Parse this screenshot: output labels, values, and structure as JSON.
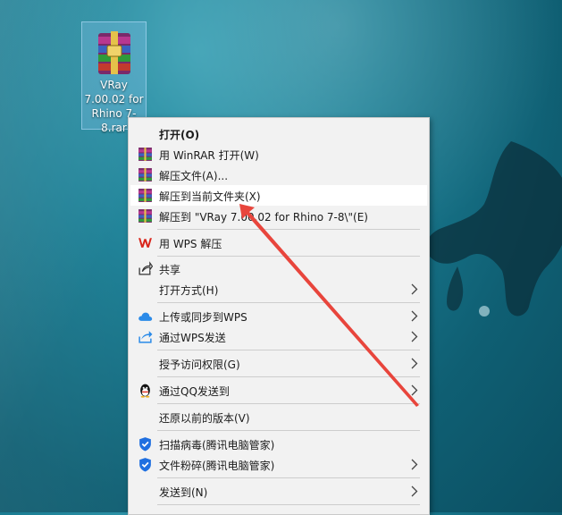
{
  "desktop": {
    "file_label": "VRay 7.00.02 for Rhino 7-8.rar"
  },
  "context_menu": {
    "items": [
      {
        "label": "打开(O)"
      },
      {
        "label": "用 WinRAR 打开(W)"
      },
      {
        "label": "解压文件(A)..."
      },
      {
        "label": "解压到当前文件夹(X)"
      },
      {
        "label": "解压到 \"VRay 7.00.02 for Rhino 7-8\\\"(E)"
      },
      {
        "label": "用 WPS 解压"
      },
      {
        "label": "共享"
      },
      {
        "label": "打开方式(H)"
      },
      {
        "label": "上传或同步到WPS"
      },
      {
        "label": "通过WPS发送"
      },
      {
        "label": "授予访问权限(G)"
      },
      {
        "label": "通过QQ发送到"
      },
      {
        "label": "还原以前的版本(V)"
      },
      {
        "label": "扫描病毒(腾讯电脑管家)"
      },
      {
        "label": "文件粉碎(腾讯电脑管家)"
      },
      {
        "label": "发送到(N)"
      }
    ],
    "highlighted_item": "解压到当前文件夹(X)"
  },
  "colors": {
    "annotation_arrow": "#e8453c",
    "wps_red": "#d9261c",
    "qqguard_blue": "#1f6fe0",
    "menu_background": "#f2f2f2"
  },
  "icons": {
    "winrar": "winrar-icon",
    "wps": "wps-icon",
    "share": "share-icon",
    "cloud": "cloud-sync-icon",
    "send": "send-icon",
    "qq": "qq-penguin-icon",
    "shield": "shield-icon",
    "submenu": "chevron-right-icon"
  }
}
